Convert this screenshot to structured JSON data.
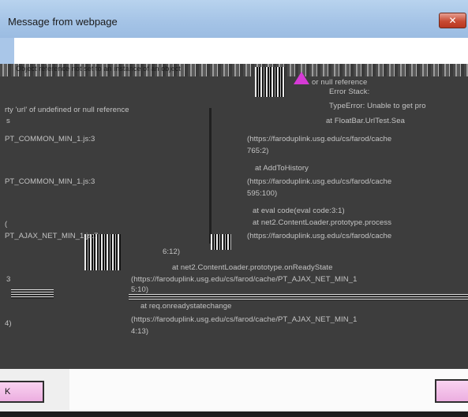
{
  "window": {
    "title": "Message from webpage",
    "close_glyph": "✕"
  },
  "lines": {
    "l01": "Object reference not set to an instance of an object",
    "l02": "or null reference",
    "l03": "Error Stack:",
    "l04": "rty 'url' of undefined or null reference",
    "l05": "TypeError: Unable to get pro",
    "l06": "s",
    "l07": "at FloatBar.UrlTest.Sea",
    "l08": "PT_COMMON_MIN_1.js:3",
    "l09": "(https://faroduplink.usg.edu/cs/farod/cache",
    "l10": "765:2)",
    "l11": "at AddToHistory",
    "l12": "PT_COMMON_MIN_1.js:3",
    "l13": "(https://faroduplink.usg.edu/cs/farod/cache",
    "l14": "595:100)",
    "l15": "at eval code(eval code:3:1)",
    "l16": "at net2.ContentLoader.prototype.process",
    "l17": "(",
    "l18": "PT_AJAX_NET_MIN_1.js:7",
    "l19": "(https://faroduplink.usg.edu/cs/farod/cache",
    "l20": "6:12)",
    "l21": "at net2.ContentLoader.prototype.onReadyState",
    "l22": "3",
    "l23": "(https://faroduplink.usg.edu/cs/farod/cache/PT_AJAX_NET_MIN_1",
    "l24": "5:10)",
    "l25": "at req.onreadystatechange",
    "l26": "4)",
    "l27": "(https://faroduplink.usg.edu/cs/farod/cache/PT_AJAX_NET_MIN_1",
    "l28": "4:13)"
  },
  "buttons": {
    "ok_label": "K"
  }
}
